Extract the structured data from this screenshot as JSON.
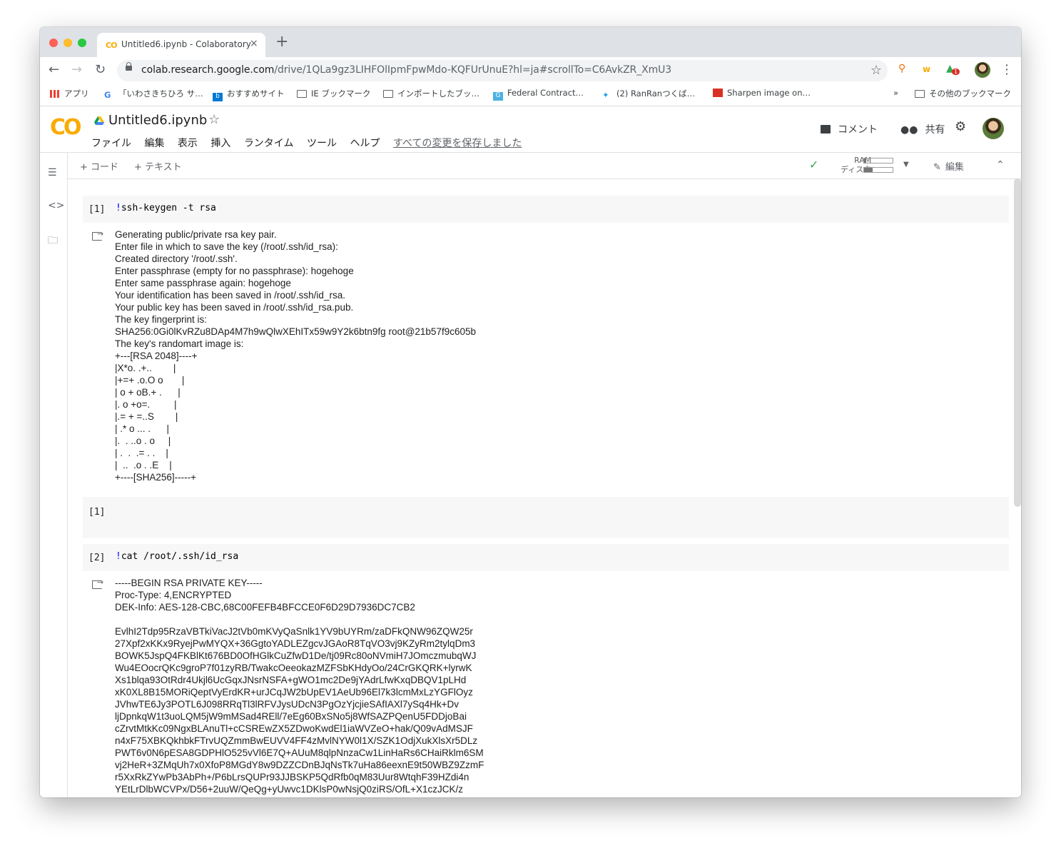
{
  "browser": {
    "tab_title": "Untitled6.ipynb - Colaboratory",
    "tab_close": "×",
    "new_tab": "+",
    "url_host": "colab.research.google.com",
    "url_path": "/drive/1QLa9gz3LIHFOlIpmFpwMdo-KQFUrUnuE?hl=ja#scrollTo=C6AvkZR_XmU3",
    "ext_badge": "1",
    "bookmarks": [
      "アプリ",
      "「いわさきちひろ サ…",
      "おすすめサイト",
      "IE ブックマーク",
      "インポートしたブッ…",
      "Federal Contract…",
      "(2) RanRanつくば…",
      "Sharpen image on…"
    ],
    "bookmarks_more": "»",
    "other_bookmarks": "その他のブックマーク"
  },
  "colab": {
    "logo": "CO",
    "notebook_name": "Untitled6.ipynb",
    "menu": [
      "ファイル",
      "編集",
      "表示",
      "挿入",
      "ランタイム",
      "ツール",
      "ヘルプ"
    ],
    "save_status": "すべての変更を保存しました",
    "comment_label": "コメント",
    "share_label": "共有",
    "add_code": "+ コード",
    "add_text": "+ テキスト",
    "ram_label": "RAM",
    "disk_label": "ディスク",
    "edit_label": "編集"
  },
  "cells": [
    {
      "exec_count": "[1]",
      "code": "ssh-keygen -t rsa",
      "output": [
        "Generating public/private rsa key pair.",
        "Enter file in which to save the key (/root/.ssh/id_rsa):",
        "Created directory '/root/.ssh'.",
        "Enter passphrase (empty for no passphrase): hogehoge",
        "Enter same passphrase again: hogehoge",
        "Your identification has been saved in /root/.ssh/id_rsa.",
        "Your public key has been saved in /root/.ssh/id_rsa.pub.",
        "The key fingerprint is:",
        "SHA256:0Gi0lKvRZu8DAp4M7h9wQlwXEhITx59w9Y2k6btn9fg root@21b57f9c605b",
        "The key's randomart image is:",
        "+---[RSA 2048]----+",
        "|X*o. .+..        |",
        "|+=+ .o.O o       |",
        "| o + oB.+ .      |",
        "|. o +o=.         |",
        "|.= + =..S        |",
        "| .* o ... .      |",
        "|.  . ..o . o     |",
        "| .  .  .= . .    |",
        "|  ..  .o . .E    |",
        "+----[SHA256]-----+"
      ]
    },
    {
      "exec_count": "[1]",
      "code": "",
      "output": []
    },
    {
      "exec_count": "[2]",
      "code": "cat /root/.ssh/id_rsa",
      "output": [
        "-----BEGIN RSA PRIVATE KEY-----",
        "Proc-Type: 4,ENCRYPTED",
        "DEK-Info: AES-128-CBC,68C00FEFB4BFCCE0F6D29D7936DC7CB2",
        "",
        "EvlhI2Tdp95RzaVBTkiVacJ2tVb0mKVyQaSnlk1YV9bUYRm/zaDFkQNW96ZQW25r",
        "27Xpf2xKKx9RyejPwMYQX+36GgtoYADLEZgcvJGAoR8TqVO3vj9KZyRm2tylqDm3",
        "BOWK5JspQ4FKBlKt676BD0OfHGlkCuZfwD1De/tj09Rc80oNVmiH7JOmczmubqWJ",
        "Wu4EOocrQKc9groP7f01zyRB/TwakcOeeokazMZFSbKHdyOo/24CrGKQRK+lyrwK",
        "Xs1blqa93OtRdr4Ukjl6UcGqxJNsrNSFA+gWO1mc2De9jYAdrLfwKxqDBQV1pLHd",
        "xK0XL8B15MORiQeptVyErdKR+urJCqJW2bUpEV1AeUb96El7k3lcmMxLzYGFlOyz",
        "JVhwTE6Jy3POTL6J098RRqTl3lRFVJysUDcN3PgOzYjcjieSAfIAXl7ySq4Hk+Dv",
        "ljDpnkqW1t3uoLQM5jW9mMSad4REll/7eEg60BxSNo5j8WfSAZPQenU5FDDjoBai",
        "cZrvtMtkKc09NgxBLAnuTl+cCSREwZX5ZDwoKwdEl1iaWVZeO+hak/Q09vAdMSJF",
        "n4xF75XBKQkhbkFTrvUQZmmBwEUVV4FF4zMvlNYW0l1X/SZK1OdjXukXlsXr5DLz",
        "PWT6v0N6pESA8GDPHlO525vVl6E7Q+AUuM8qlpNnzaCw1LinHaRs6CHaiRklm6SM",
        "vj2HeR+3ZMqUh7x0XfoP8MGdY8w9DZZCDnBJqNsTk7uHa86eexnE9t50WBZ9ZzmF",
        "r5XxRkZYwPb3AbPh+/P6bLrsQUPr93JJBSKP5QdRfb0qM83Uur8WtqhF39HZdi4n",
        "YEtLrDlbWCVPx/D56+2uuW/QeQg+yUwvc1DKlsP0wNsjQ0ziRS/OfL+X1czJCK/z"
      ]
    }
  ]
}
